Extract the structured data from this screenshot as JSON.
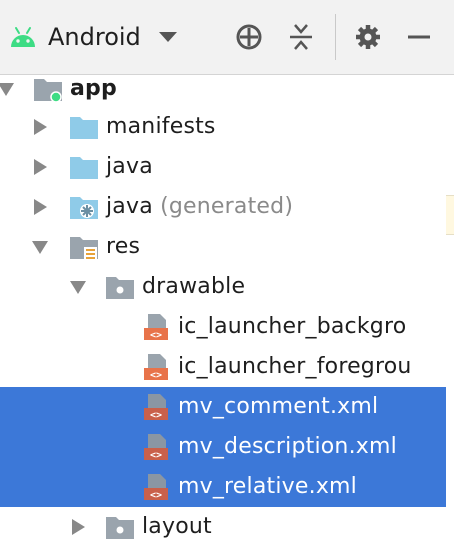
{
  "toolbar": {
    "view": "Android",
    "icons": [
      "android-icon",
      "dropdown-caret-icon",
      "crosshair-icon",
      "collapse-all-icon",
      "gear-icon",
      "minimize-icon"
    ]
  },
  "tree": {
    "app": {
      "label": "app",
      "icon": "module-folder-icon"
    },
    "manifests": {
      "label": "manifests",
      "icon": "folder-icon"
    },
    "java": {
      "label": "java",
      "icon": "folder-icon"
    },
    "java_generated": {
      "label": "java",
      "suffix": "(generated)",
      "icon": "generated-folder-icon"
    },
    "res": {
      "label": "res",
      "icon": "resources-folder-icon"
    },
    "drawable": {
      "label": "drawable",
      "icon": "package-folder-icon"
    },
    "files": [
      {
        "label": "ic_launcher_backgro",
        "icon": "xml-file-icon",
        "selected": false
      },
      {
        "label": "ic_launcher_foregrou",
        "icon": "xml-file-icon",
        "selected": false
      },
      {
        "label": "mv_comment.xml",
        "icon": "xml-file-icon",
        "selected": true
      },
      {
        "label": "mv_description.xml",
        "icon": "xml-file-icon",
        "selected": true
      },
      {
        "label": "mv_relative.xml",
        "icon": "xml-file-icon",
        "selected": true
      }
    ],
    "layout": {
      "label": "layout",
      "icon": "package-folder-icon"
    }
  },
  "colors": {
    "selection": "#3c78d8",
    "folder_blue": "#8fcbe8",
    "xml_badge": "#e8734a",
    "android_green": "#3ddc84"
  }
}
